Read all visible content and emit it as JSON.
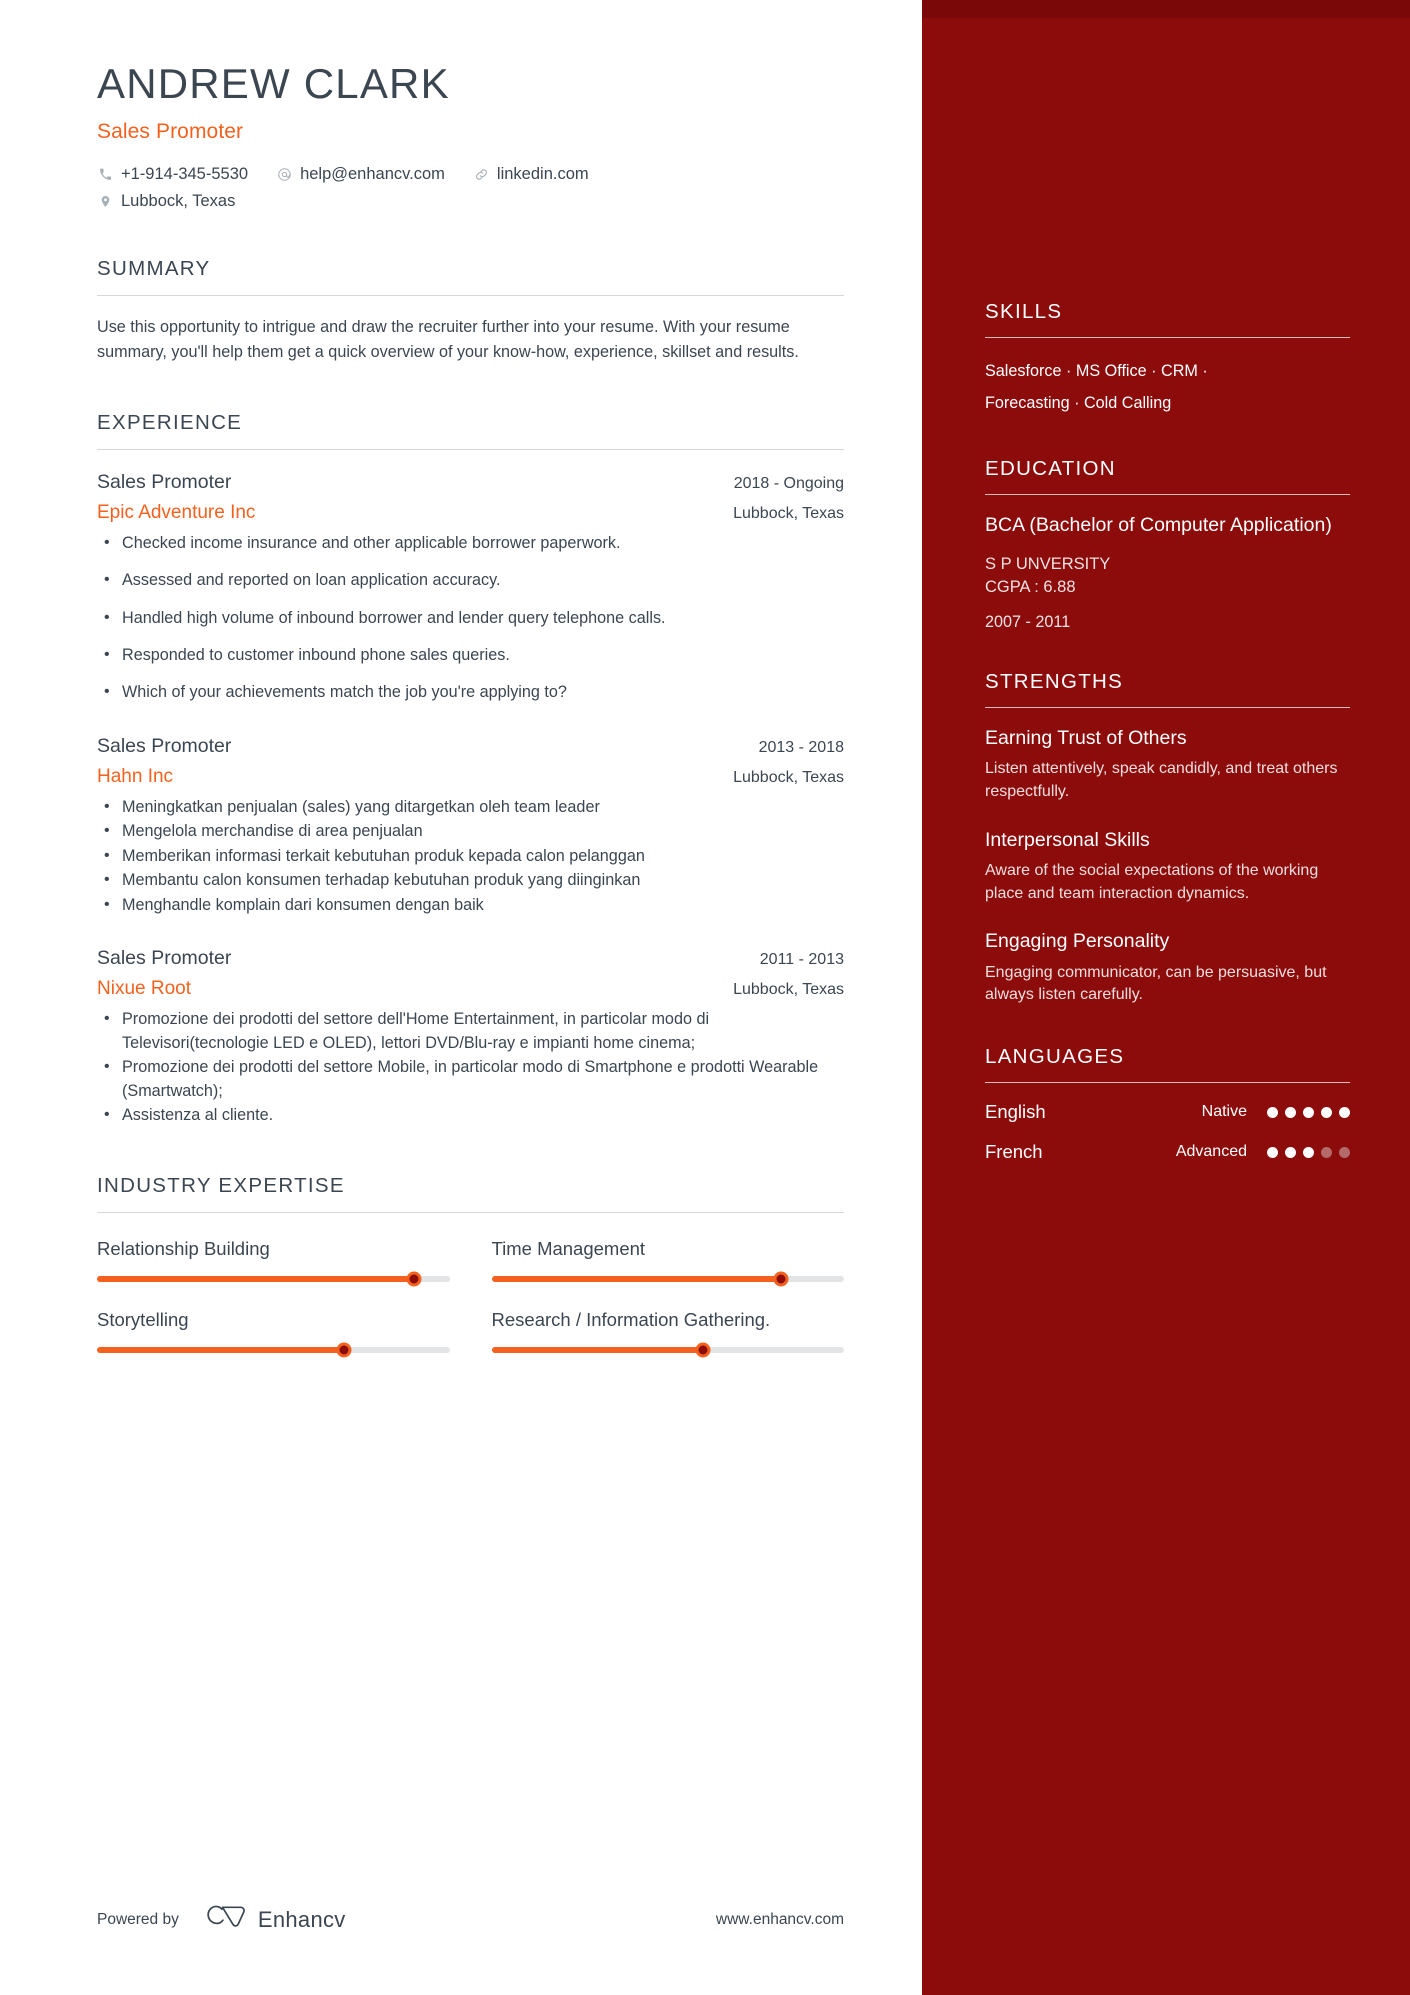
{
  "header": {
    "name": "ANDREW CLARK",
    "job_title": "Sales Promoter",
    "contacts": [
      {
        "icon": "phone-icon",
        "text": "+1-914-345-5530"
      },
      {
        "icon": "email-icon",
        "text": "help@enhancv.com"
      },
      {
        "icon": "link-icon",
        "text": "linkedin.com"
      }
    ],
    "location": {
      "icon": "location-pin-icon",
      "text": "Lubbock, Texas"
    }
  },
  "summary": {
    "title": "SUMMARY",
    "text": "Use this opportunity to intrigue and draw the recruiter further into your resume. With your resume summary, you'll help them get a quick overview of your know-how, experience, skillset and results."
  },
  "experience": {
    "title": "EXPERIENCE",
    "jobs": [
      {
        "position": "Sales Promoter",
        "date": "2018 - Ongoing",
        "company": "Epic Adventure Inc",
        "location": "Lubbock, Texas",
        "spaced": true,
        "bullets": [
          "Checked income insurance and other applicable borrower paperwork.",
          "Assessed and reported on loan application accuracy.",
          "Handled high volume of inbound borrower and lender query telephone calls.",
          "Responded to customer inbound phone sales queries.",
          "Which of your achievements match the job you're applying to?"
        ]
      },
      {
        "position": "Sales Promoter",
        "date": "2013 - 2018",
        "company": "Hahn Inc",
        "location": "Lubbock, Texas",
        "spaced": false,
        "bullets": [
          "Meningkatkan penjualan (sales) yang ditargetkan oleh team leader",
          "Mengelola merchandise di area penjualan",
          "Memberikan informasi terkait kebutuhan produk kepada calon pelanggan",
          "Membantu calon konsumen terhadap kebutuhan produk yang diinginkan",
          "Menghandle komplain dari konsumen dengan baik"
        ]
      },
      {
        "position": "Sales Promoter",
        "date": "2011 - 2013",
        "company": "Nixue Root",
        "location": "Lubbock, Texas",
        "spaced": false,
        "bullets": [
          "Promozione dei prodotti del settore dell'Home Entertainment, in particolar modo di Televisori(tecnologie LED e OLED), lettori DVD/Blu-ray e impianti home cinema;",
          "Promozione dei prodotti del settore Mobile, in particolar modo di Smartphone e prodotti Wearable (Smartwatch);",
          "Assistenza al cliente."
        ]
      }
    ]
  },
  "industry_expertise": {
    "title": "INDUSTRY EXPERTISE",
    "items": [
      {
        "label": "Relationship Building",
        "value": 90
      },
      {
        "label": "Time Management",
        "value": 82
      },
      {
        "label": "Storytelling",
        "value": 70
      },
      {
        "label": "Research / Information Gathering.",
        "value": 60
      }
    ]
  },
  "footer": {
    "powered_by": "Powered by",
    "brand": "Enhancv",
    "url": "www.enhancv.com"
  },
  "sidebar": {
    "skills": {
      "title": "SKILLS",
      "lines": [
        "Salesforce · MS Office · CRM ·",
        "Forecasting · Cold Calling"
      ]
    },
    "education": {
      "title": "EDUCATION",
      "degree": "BCA  (Bachelor of Computer Application)",
      "school": "S P UNVERSITY",
      "gpa": "CGPA : 6.88",
      "date": "2007 - 2011"
    },
    "strengths": {
      "title": "STRENGTHS",
      "items": [
        {
          "name": "Earning Trust of Others",
          "desc": "Listen attentively, speak candidly, and treat others respectfully."
        },
        {
          "name": "Interpersonal Skills",
          "desc": "Aware of the social expectations of the working place and team interaction dynamics."
        },
        {
          "name": "Engaging Personality",
          "desc": "Engaging communicator, can be persuasive, but always listen carefully."
        }
      ]
    },
    "languages": {
      "title": "LANGUAGES",
      "items": [
        {
          "name": "English",
          "level": "Native",
          "filled": 5,
          "total": 5
        },
        {
          "name": "French",
          "level": "Advanced",
          "filled": 3,
          "total": 5
        }
      ]
    }
  },
  "colors": {
    "accent_orange": "#f4611e",
    "sidebar_red": "#8c0b0b",
    "text_dark": "#3b4651"
  }
}
